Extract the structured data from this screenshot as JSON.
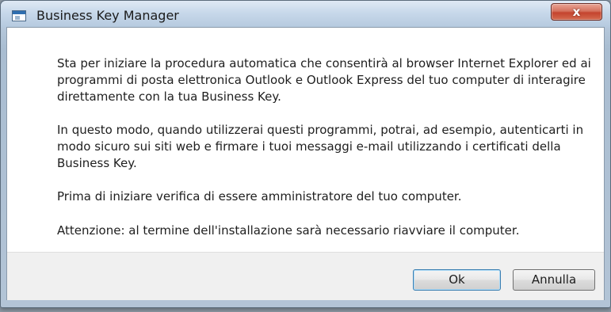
{
  "window": {
    "title": "Business Key Manager",
    "close_glyph": "x"
  },
  "content": {
    "paragraphs": [
      "Sta per iniziare la procedura automatica che consentirà al browser Internet Explorer ed ai programmi di posta elettronica Outlook e Outlook Express del tuo computer di interagire direttamente con la tua Business Key.",
      "In questo modo, quando utilizzerai questi programmi, potrai, ad esempio, autenticarti in modo sicuro sui siti web e firmare i tuoi messaggi e-mail utilizzando i certificati della Business Key.",
      "Prima di iniziare verifica di essere amministratore del tuo computer.",
      "Attenzione: al termine dell'installazione sarà necessario riavviare il computer."
    ]
  },
  "buttons": {
    "ok": "Ok",
    "cancel": "Annulla"
  },
  "colors": {
    "close_button": "#c4442e",
    "default_button_border": "#3c7fb1"
  }
}
